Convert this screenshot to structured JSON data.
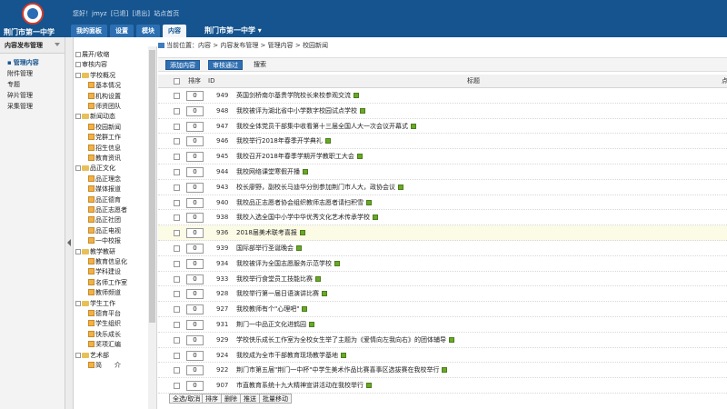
{
  "header": {
    "school_name": "荆门市第一中学",
    "greeting": "您好！jmyz",
    "logout_label": "[退出]",
    "links": [
      "[已退]",
      "站点首页"
    ],
    "site_select": "荆门市第一中学",
    "nav": [
      "我的面板",
      "设置",
      "模块",
      "内容"
    ]
  },
  "sidebar": {
    "title": "内容发布管理",
    "items": [
      "管理内容",
      "附件管理",
      "专题",
      "碎片管理",
      "采集管理"
    ]
  },
  "tree": {
    "top": [
      "展开/收缩",
      "审核内容"
    ],
    "groups": [
      {
        "name": "学校概况",
        "items": [
          "基本情况",
          "机构设置",
          "师资团队"
        ]
      },
      {
        "name": "新闻动态",
        "items": [
          "校园新闻",
          "党群工作",
          "招生信息",
          "教育资讯"
        ]
      },
      {
        "name": "品正文化",
        "items": [
          "品正理念",
          "媒体报道",
          "品正德育",
          "品正志愿者",
          "品正社团",
          "品正电视",
          "一中校报"
        ]
      },
      {
        "name": "教学教研",
        "items": [
          "教育信息化",
          "学科建设",
          "名师工作室",
          "教师频道"
        ]
      },
      {
        "name": "学生工作",
        "items": [
          "德育平台",
          "学生组织",
          "快乐成长",
          "奖项汇编"
        ]
      },
      {
        "name": "艺术部",
        "items": [
          "简　　介"
        ]
      }
    ]
  },
  "breadcrumb": "当前位置：内容 > 内容发布管理 > 管理内容 > 校园新闻",
  "toolbar": {
    "add": "添加内容",
    "approve": "审核通过",
    "search": "搜索"
  },
  "table": {
    "headers": {
      "order": "排序",
      "id": "ID",
      "title": "标题",
      "extra": "点"
    },
    "rows": [
      {
        "order": "0",
        "id": "949",
        "title": "英国剑桥南尔基贵学院校长来校参观交流"
      },
      {
        "order": "0",
        "id": "948",
        "title": "我校被评为湖北省中小学数字校园试点学校"
      },
      {
        "order": "0",
        "id": "947",
        "title": "我校全体党员干部集中收看第十三届全国人大一次会议开幕式"
      },
      {
        "order": "0",
        "id": "946",
        "title": "我校举行2018年春季开学典礼"
      },
      {
        "order": "0",
        "id": "945",
        "title": "我校召开2018年春季学期开学教职工大会"
      },
      {
        "order": "0",
        "id": "944",
        "title": "我校网络课堂寒假开播"
      },
      {
        "order": "0",
        "id": "943",
        "title": "校长廖野，副校长马迪华分别参加荆门市人大，政协会议"
      },
      {
        "order": "0",
        "id": "940",
        "title": "我校品正志愿者协会组织教师志愿者请扫积雪"
      },
      {
        "order": "0",
        "id": "938",
        "title": "我校入选全国中小学中华优秀文化艺术传承学校"
      },
      {
        "order": "0",
        "id": "936",
        "title": "2018届美术联考喜报"
      },
      {
        "order": "0",
        "id": "939",
        "title": "国际部举行圣诞晚会"
      },
      {
        "order": "0",
        "id": "934",
        "title": "我校被评为全国志愿服务示范学校"
      },
      {
        "order": "0",
        "id": "933",
        "title": "我校举行食堂员工技能比赛"
      },
      {
        "order": "0",
        "id": "928",
        "title": "我校举行第一届日语演讲比赛"
      },
      {
        "order": "0",
        "id": "927",
        "title": "我校教师有个\"心理吧\""
      },
      {
        "order": "0",
        "id": "931",
        "title": "荆门一中品正文化进鹤园"
      },
      {
        "order": "0",
        "id": "929",
        "title": "学校侠乐成长工作室为全校女生举了主题为《爱情向左我向右》的团体辅导"
      },
      {
        "order": "0",
        "id": "924",
        "title": "我校成为全市干部教育现场教学基地"
      },
      {
        "order": "0",
        "id": "922",
        "title": "荆门市第五届\"荆门一中杯\"中学生美术作品比赛喜事区选拔赛在我校举行"
      },
      {
        "order": "0",
        "id": "907",
        "title": "市直教育系统十九大精神宣讲活动在我校举行"
      }
    ],
    "highlight_row": 9
  },
  "bottom_bar": [
    "全选/取消",
    "排序",
    "删除",
    "推送",
    "批量移动"
  ]
}
